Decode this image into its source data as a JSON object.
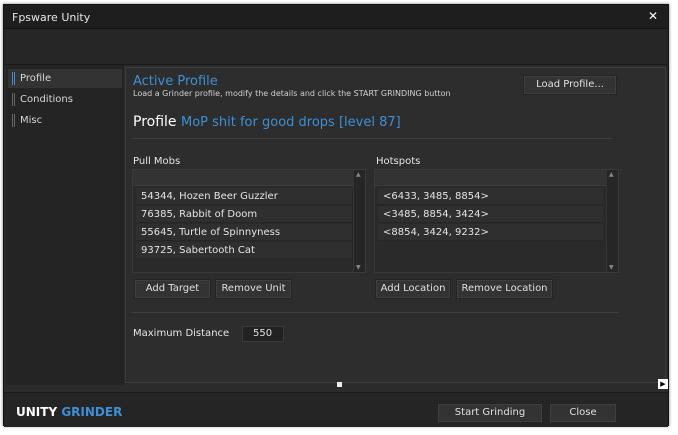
{
  "window": {
    "title": "Fpsware Unity"
  },
  "sidebar": {
    "items": [
      {
        "label": "Profile",
        "active": true
      },
      {
        "label": "Conditions",
        "active": false
      },
      {
        "label": "Misc",
        "active": false
      }
    ]
  },
  "active_profile": {
    "title": "Active Profile",
    "description": "Load a Grinder profile, modify the details and click the START GRINDING button",
    "load_button": "Load Profile...",
    "profile_label": "Profile",
    "profile_name": "MoP shit for good drops [level 87]"
  },
  "pull_mobs": {
    "label": "Pull Mobs",
    "items": [
      "54344, Hozen Beer Guzzler",
      "76385, Rabbit of Doom",
      "55645, Turtle of Spinnyness",
      "93725, Sabertooth Cat"
    ],
    "add_button": "Add Target",
    "remove_button": "Remove Unit"
  },
  "hotspots": {
    "label": "Hotspots",
    "items": [
      "<6433, 3485, 8854>",
      "<3485, 8854, 3424>",
      "<8854, 3424, 9232>"
    ],
    "add_button": "Add Location",
    "remove_button": "Remove Location"
  },
  "max_distance": {
    "label": "Maximum Distance",
    "value": "550"
  },
  "footer": {
    "brand_part1": "UNITY",
    "brand_part2": "GRINDER",
    "start_button": "Start Grinding",
    "close_button": "Close"
  },
  "colors": {
    "accent": "#3d8fd6",
    "background": "#2b2b2b",
    "panel": "#2d2d2d"
  }
}
